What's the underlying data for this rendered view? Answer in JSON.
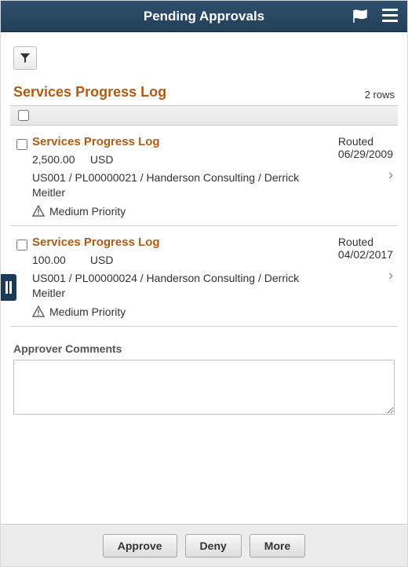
{
  "header": {
    "title": "Pending Approvals"
  },
  "section": {
    "title": "Services Progress Log",
    "row_count": "2 rows"
  },
  "items": [
    {
      "title": "Services Progress Log",
      "amount": "2,500.00",
      "currency": "USD",
      "path": "US001 / PL00000021 / Handerson Consulting / Derrick Meitler",
      "priority": "Medium Priority",
      "status": "Routed",
      "date": "06/29/2009"
    },
    {
      "title": "Services Progress Log",
      "amount": "100.00",
      "currency": "USD",
      "path": "US001 / PL00000024 / Handerson Consulting / Derrick Meitler",
      "priority": "Medium Priority",
      "status": "Routed",
      "date": "04/02/2017"
    }
  ],
  "comments": {
    "label": "Approver Comments",
    "value": ""
  },
  "footer": {
    "approve": "Approve",
    "deny": "Deny",
    "more": "More"
  }
}
